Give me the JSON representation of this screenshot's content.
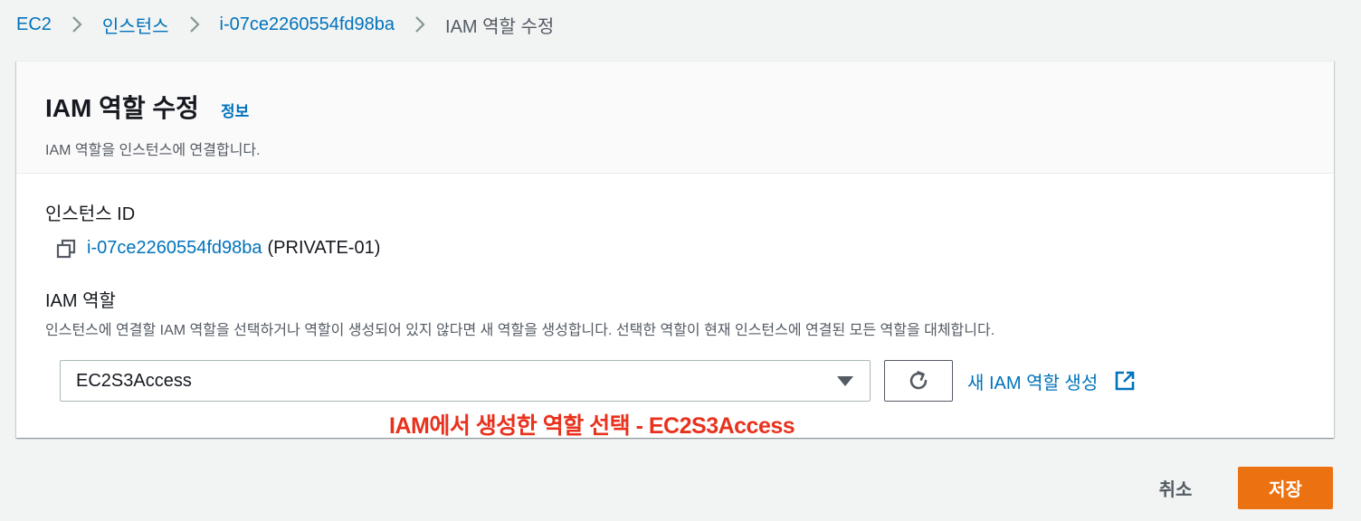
{
  "breadcrumb": {
    "items": [
      {
        "label": "EC2",
        "link": true
      },
      {
        "label": "인스턴스",
        "link": true
      },
      {
        "label": "i-07ce2260554fd98ba",
        "link": true
      },
      {
        "label": "IAM 역할 수정",
        "link": false
      }
    ]
  },
  "panel": {
    "title": "IAM 역할 수정",
    "info_link": "정보",
    "description": "IAM 역할을 인스턴스에 연결합니다."
  },
  "instance": {
    "label": "인스턴스 ID",
    "id": "i-07ce2260554fd98ba",
    "name": "(PRIVATE-01)"
  },
  "iam_role": {
    "label": "IAM 역할",
    "description": "인스턴스에 연결할 IAM 역할을 선택하거나 역할이 생성되어 있지 않다면 새 역할을 생성합니다. 선택한 역할이 현재 인스턴스에 연결된 모든 역할을 대체합니다.",
    "selected_value": "EC2S3Access",
    "create_link": "새 IAM 역할 생성"
  },
  "annotation": "IAM에서 생성한 역할 선택 - EC2S3Access",
  "footer": {
    "cancel_label": "취소",
    "save_label": "저장"
  },
  "colors": {
    "link": "#0073bb",
    "primary_button": "#ec7211",
    "annotation": "#e8321e",
    "background": "#f2f3f3"
  },
  "icons": [
    "chevron-right-icon",
    "copy-icon",
    "caret-down-icon",
    "refresh-icon",
    "external-link-icon"
  ]
}
